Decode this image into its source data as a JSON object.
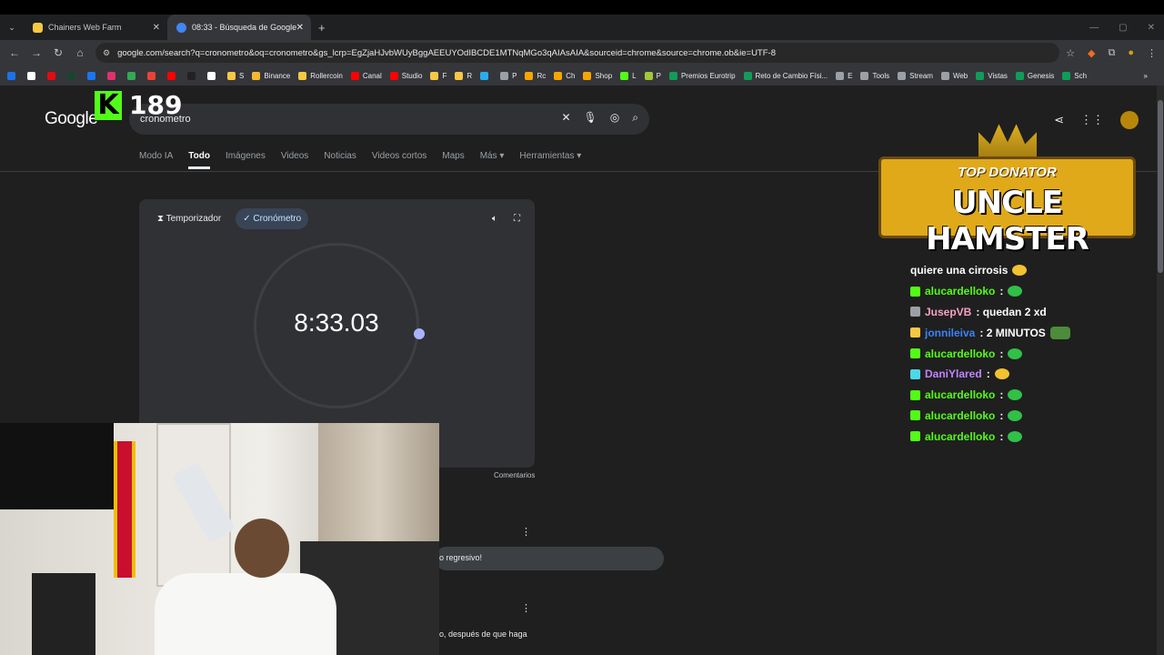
{
  "browser": {
    "tabs": [
      {
        "label": "Chainers Web Farm",
        "color": "#f7c844"
      },
      {
        "label": "08:33 - Búsqueda de Google",
        "color": "#4285f4"
      }
    ],
    "url": "google.com/search?q=cronometro&oq=cronometro&gs_lcrp=EgZjaHJvbWUyBggAEEUYOdIBCDE1MTNqMGo3qAIAsAIA&sourceid=chrome&source=chrome.ob&ie=UTF-8",
    "bookmarks": [
      {
        "label": "",
        "color": "#1a73e8"
      },
      {
        "label": "",
        "color": "#fff"
      },
      {
        "label": "",
        "color": "#e50914"
      },
      {
        "label": "",
        "color": "#1b4332"
      },
      {
        "label": "",
        "color": "#1877f2"
      },
      {
        "label": "",
        "color": "#e1306c"
      },
      {
        "label": "",
        "color": "#34a853"
      },
      {
        "label": "",
        "color": "#ea4335"
      },
      {
        "label": "",
        "color": "#ff0000"
      },
      {
        "label": "",
        "color": "#222"
      },
      {
        "label": "",
        "color": "#fff"
      },
      {
        "label": "S",
        "color": "#f7c844"
      },
      {
        "label": "Binance",
        "color": "#f3ba2f"
      },
      {
        "label": "Rollercoin",
        "color": "#f7c844"
      },
      {
        "label": "Canal",
        "color": "#ff0000"
      },
      {
        "label": "Studio",
        "color": "#ff0000"
      },
      {
        "label": "F",
        "color": "#f7c844"
      },
      {
        "label": "R",
        "color": "#f7c844"
      },
      {
        "label": "",
        "color": "#2aabee"
      },
      {
        "label": "P",
        "color": "#9aa0a6"
      },
      {
        "label": "Rc",
        "color": "#f7a600"
      },
      {
        "label": "Ch",
        "color": "#f7a600"
      },
      {
        "label": "Shop",
        "color": "#f7a600"
      },
      {
        "label": "L",
        "color": "#53fc18"
      },
      {
        "label": "P",
        "color": "#a4c639"
      },
      {
        "label": "Premios Eurotrip",
        "color": "#0f9d58"
      },
      {
        "label": "Reto de Cambio Físi...",
        "color": "#0f9d58"
      },
      {
        "label": "E",
        "color": "#9aa0a6"
      },
      {
        "label": "Tools",
        "color": "#9aa0a6"
      },
      {
        "label": "Stream",
        "color": "#9aa0a6"
      },
      {
        "label": "Web",
        "color": "#9aa0a6"
      },
      {
        "label": "Vistas",
        "color": "#0f9d58"
      },
      {
        "label": "Genesis",
        "color": "#0f9d58"
      },
      {
        "label": "Sch",
        "color": "#0f9d58"
      }
    ],
    "bookmarks_more": "»"
  },
  "google": {
    "logo": "Google",
    "query": "cronometro",
    "nav_tabs": [
      "Modo IA",
      "Todo",
      "Imágenes",
      "Videos",
      "Noticias",
      "Videos cortos",
      "Maps",
      "Más ▾",
      "Herramientas ▾"
    ],
    "active_tab": "Todo",
    "stopwatch": {
      "mode_timer": "Temporizador",
      "mode_stopwatch": "Cronómetro",
      "time": "8:33.03"
    },
    "comments": "Comentarios",
    "snippet1": "o regresivo!",
    "snippet2": "o, después de que haga"
  },
  "overlay": {
    "kick_count": "189",
    "kick_letter": "K",
    "banner_top": "TOP DONATOR",
    "banner_name": "UNCLE HAMSTER"
  },
  "chat": [
    {
      "user": "",
      "msg": "quiere una cirrosis",
      "badge": "",
      "user_color": "#ffffff",
      "emote": "yellow"
    },
    {
      "user": "alucardelloko",
      "msg": ":",
      "badge": "#53fc18",
      "user_color": "#53fc18",
      "emote": "green"
    },
    {
      "user": "JusepVB",
      "msg": ": quedan 2 xd",
      "badge": "#9aa0a6",
      "user_color": "#f7a1c4",
      "emote": ""
    },
    {
      "user": "jonnileiva",
      "msg": ": 2 MINUTOS",
      "badge": "#f7c844",
      "user_color": "#3b82f6",
      "emote": "big"
    },
    {
      "user": "alucardelloko",
      "msg": ":",
      "badge": "#53fc18",
      "user_color": "#53fc18",
      "emote": "green"
    },
    {
      "user": "DaniYlared",
      "msg": ":",
      "badge": "#4dd8e8",
      "user_color": "#c084fc",
      "emote": "yellow"
    },
    {
      "user": "alucardelloko",
      "msg": ":",
      "badge": "#53fc18",
      "user_color": "#53fc18",
      "emote": "green"
    },
    {
      "user": "alucardelloko",
      "msg": ":",
      "badge": "#53fc18",
      "user_color": "#53fc18",
      "emote": "green"
    },
    {
      "user": "alucardelloko",
      "msg": ":",
      "badge": "#53fc18",
      "user_color": "#53fc18",
      "emote": "green"
    }
  ]
}
